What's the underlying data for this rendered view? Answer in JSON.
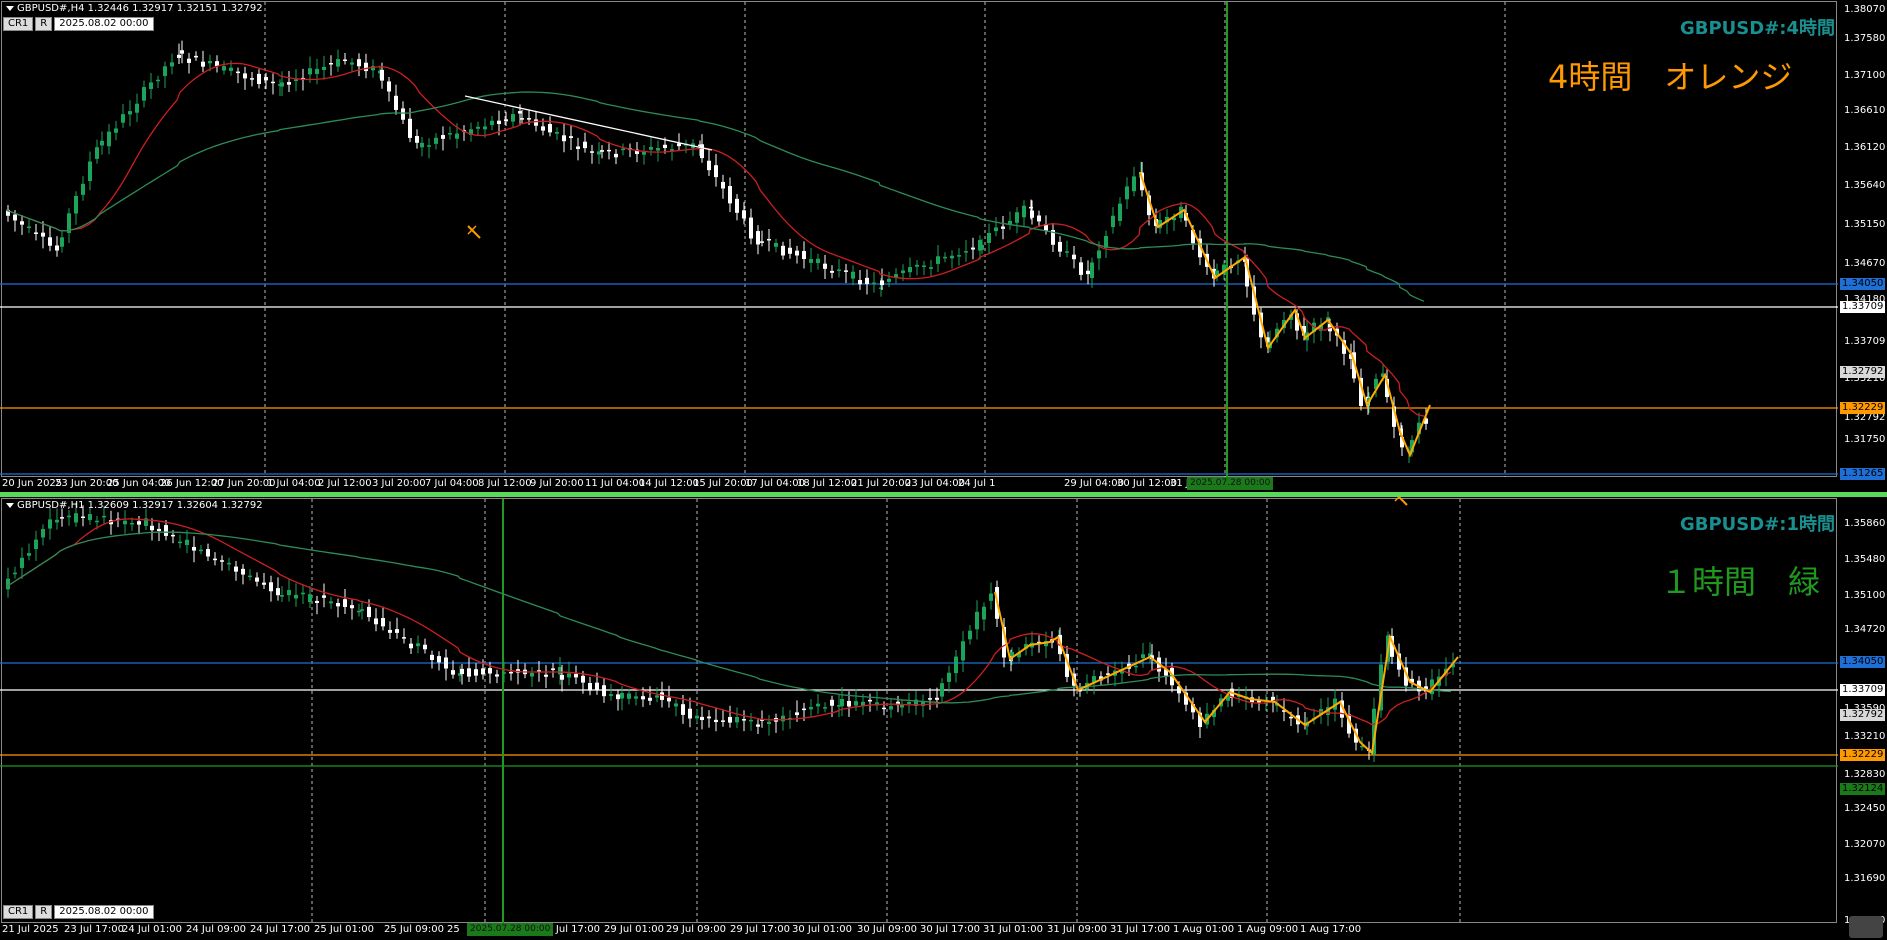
{
  "top": {
    "title": "GBPUSD#,H4  1.32446 1.32917 1.32151 1.32792",
    "cr_label": "CR1",
    "r_label": "R",
    "date_field": "2025.08.02 00:00",
    "symbol_label": "GBPUSD#:4時間",
    "jp_label": "4時間　オレンジ",
    "jp_color": "#ff9900",
    "price_ticks": [
      "1.38070",
      "1.37580",
      "1.37100",
      "1.36610",
      "1.36120",
      "1.35640",
      "1.35150",
      "1.34670",
      "1.34180",
      "1.33709",
      "1.33210",
      "1.32792",
      "1.31750",
      "1.31265"
    ],
    "price_tags": [
      {
        "text": "1.34050",
        "color": "#1e6fd6",
        "text_color": "#000"
      },
      {
        "text": "1.33709",
        "color": "#ffffff",
        "text_color": "#000"
      },
      {
        "text": "1.32792",
        "color": "#d9d9d9",
        "text_color": "#000"
      },
      {
        "text": "1.32229",
        "color": "#ff9900",
        "text_color": "#000"
      },
      {
        "text": "1.31265",
        "color": "#1e6fd6",
        "text_color": "#000"
      }
    ],
    "time_labels": [
      "20 Jun 2025",
      "23 Jun 20:00",
      "25 Jun 04:00",
      "26 Jun 12:00",
      "27 Jun 20:00",
      "1 Jul 04:00",
      "2 Jul 12:00",
      "3 Jul 20:00",
      "7 Jul 04:00",
      "8 Jul 12:00",
      "9 Jul 20:00",
      "11 Jul 04:00",
      "14 Jul 12:00",
      "15 Jul 20:00",
      "17 Jul 04:00",
      "18 Jul 12:00",
      "21 Jul 20:00",
      "23 Jul 04:00",
      "24 Jul 1",
      "29 Jul 04:00",
      "30 Jul 12:00",
      "31 Jul 20:00"
    ],
    "time_highlight": "2025.07.28 00:00"
  },
  "bottom": {
    "title": "GBPUSD#,H1  1.32609 1.32917 1.32604 1.32792",
    "cr_label": "CR1",
    "r_label": "R",
    "date_field": "2025.08.02 00:00",
    "symbol_label": "GBPUSD#:1時間",
    "jp_label": "１時間　緑",
    "jp_color": "#1f9a1f",
    "price_ticks": [
      "1.35860",
      "1.35480",
      "1.35100",
      "1.34720",
      "1.34340",
      "1.33960",
      "1.33590",
      "1.33210",
      "1.32830",
      "1.32450",
      "1.32070",
      "1.31690",
      "1.31310"
    ],
    "price_tags": [
      {
        "text": "1.34050",
        "color": "#1e6fd6",
        "text_color": "#000"
      },
      {
        "text": "1.33709",
        "color": "#ffffff",
        "text_color": "#000"
      },
      {
        "text": "1.32792",
        "color": "#d9d9d9",
        "text_color": "#000"
      },
      {
        "text": "1.32229",
        "color": "#ff9900",
        "text_color": "#000"
      },
      {
        "text": "1.32124",
        "color": "#1a7a1a",
        "text_color": "#000"
      }
    ],
    "time_labels": [
      "21 Jul 2025",
      "23 Jul 17:00",
      "24 Jul 01:00",
      "24 Jul 09:00",
      "24 Jul 17:00",
      "25 Jul 01:00",
      "25 Jul 09:00",
      "25",
      "28 Jul 09:00",
      "28 Jul 17:00",
      "29 Jul 01:00",
      "29 Jul 09:00",
      "29 Jul 17:00",
      "30 Jul 01:00",
      "30 Jul 09:00",
      "30 Jul 17:00",
      "31 Jul 01:00",
      "31 Jul 09:00",
      "31 Jul 17:00",
      "1 Aug 01:00",
      "1 Aug 09:00",
      "1 Aug 17:00"
    ],
    "time_highlight": "2025.07.28 00:00"
  },
  "colors": {
    "bull": "#1aa55a",
    "bear": "#ffffff",
    "ma_fast": "#cc1f1f",
    "ma_slow": "#2e8b57",
    "zigzag": "#ffaa00",
    "vline": "#1f9a1f",
    "hline_blue": "#1e6fd6",
    "hline_white": "#ffffff",
    "hline_orange": "#ff9900"
  }
}
